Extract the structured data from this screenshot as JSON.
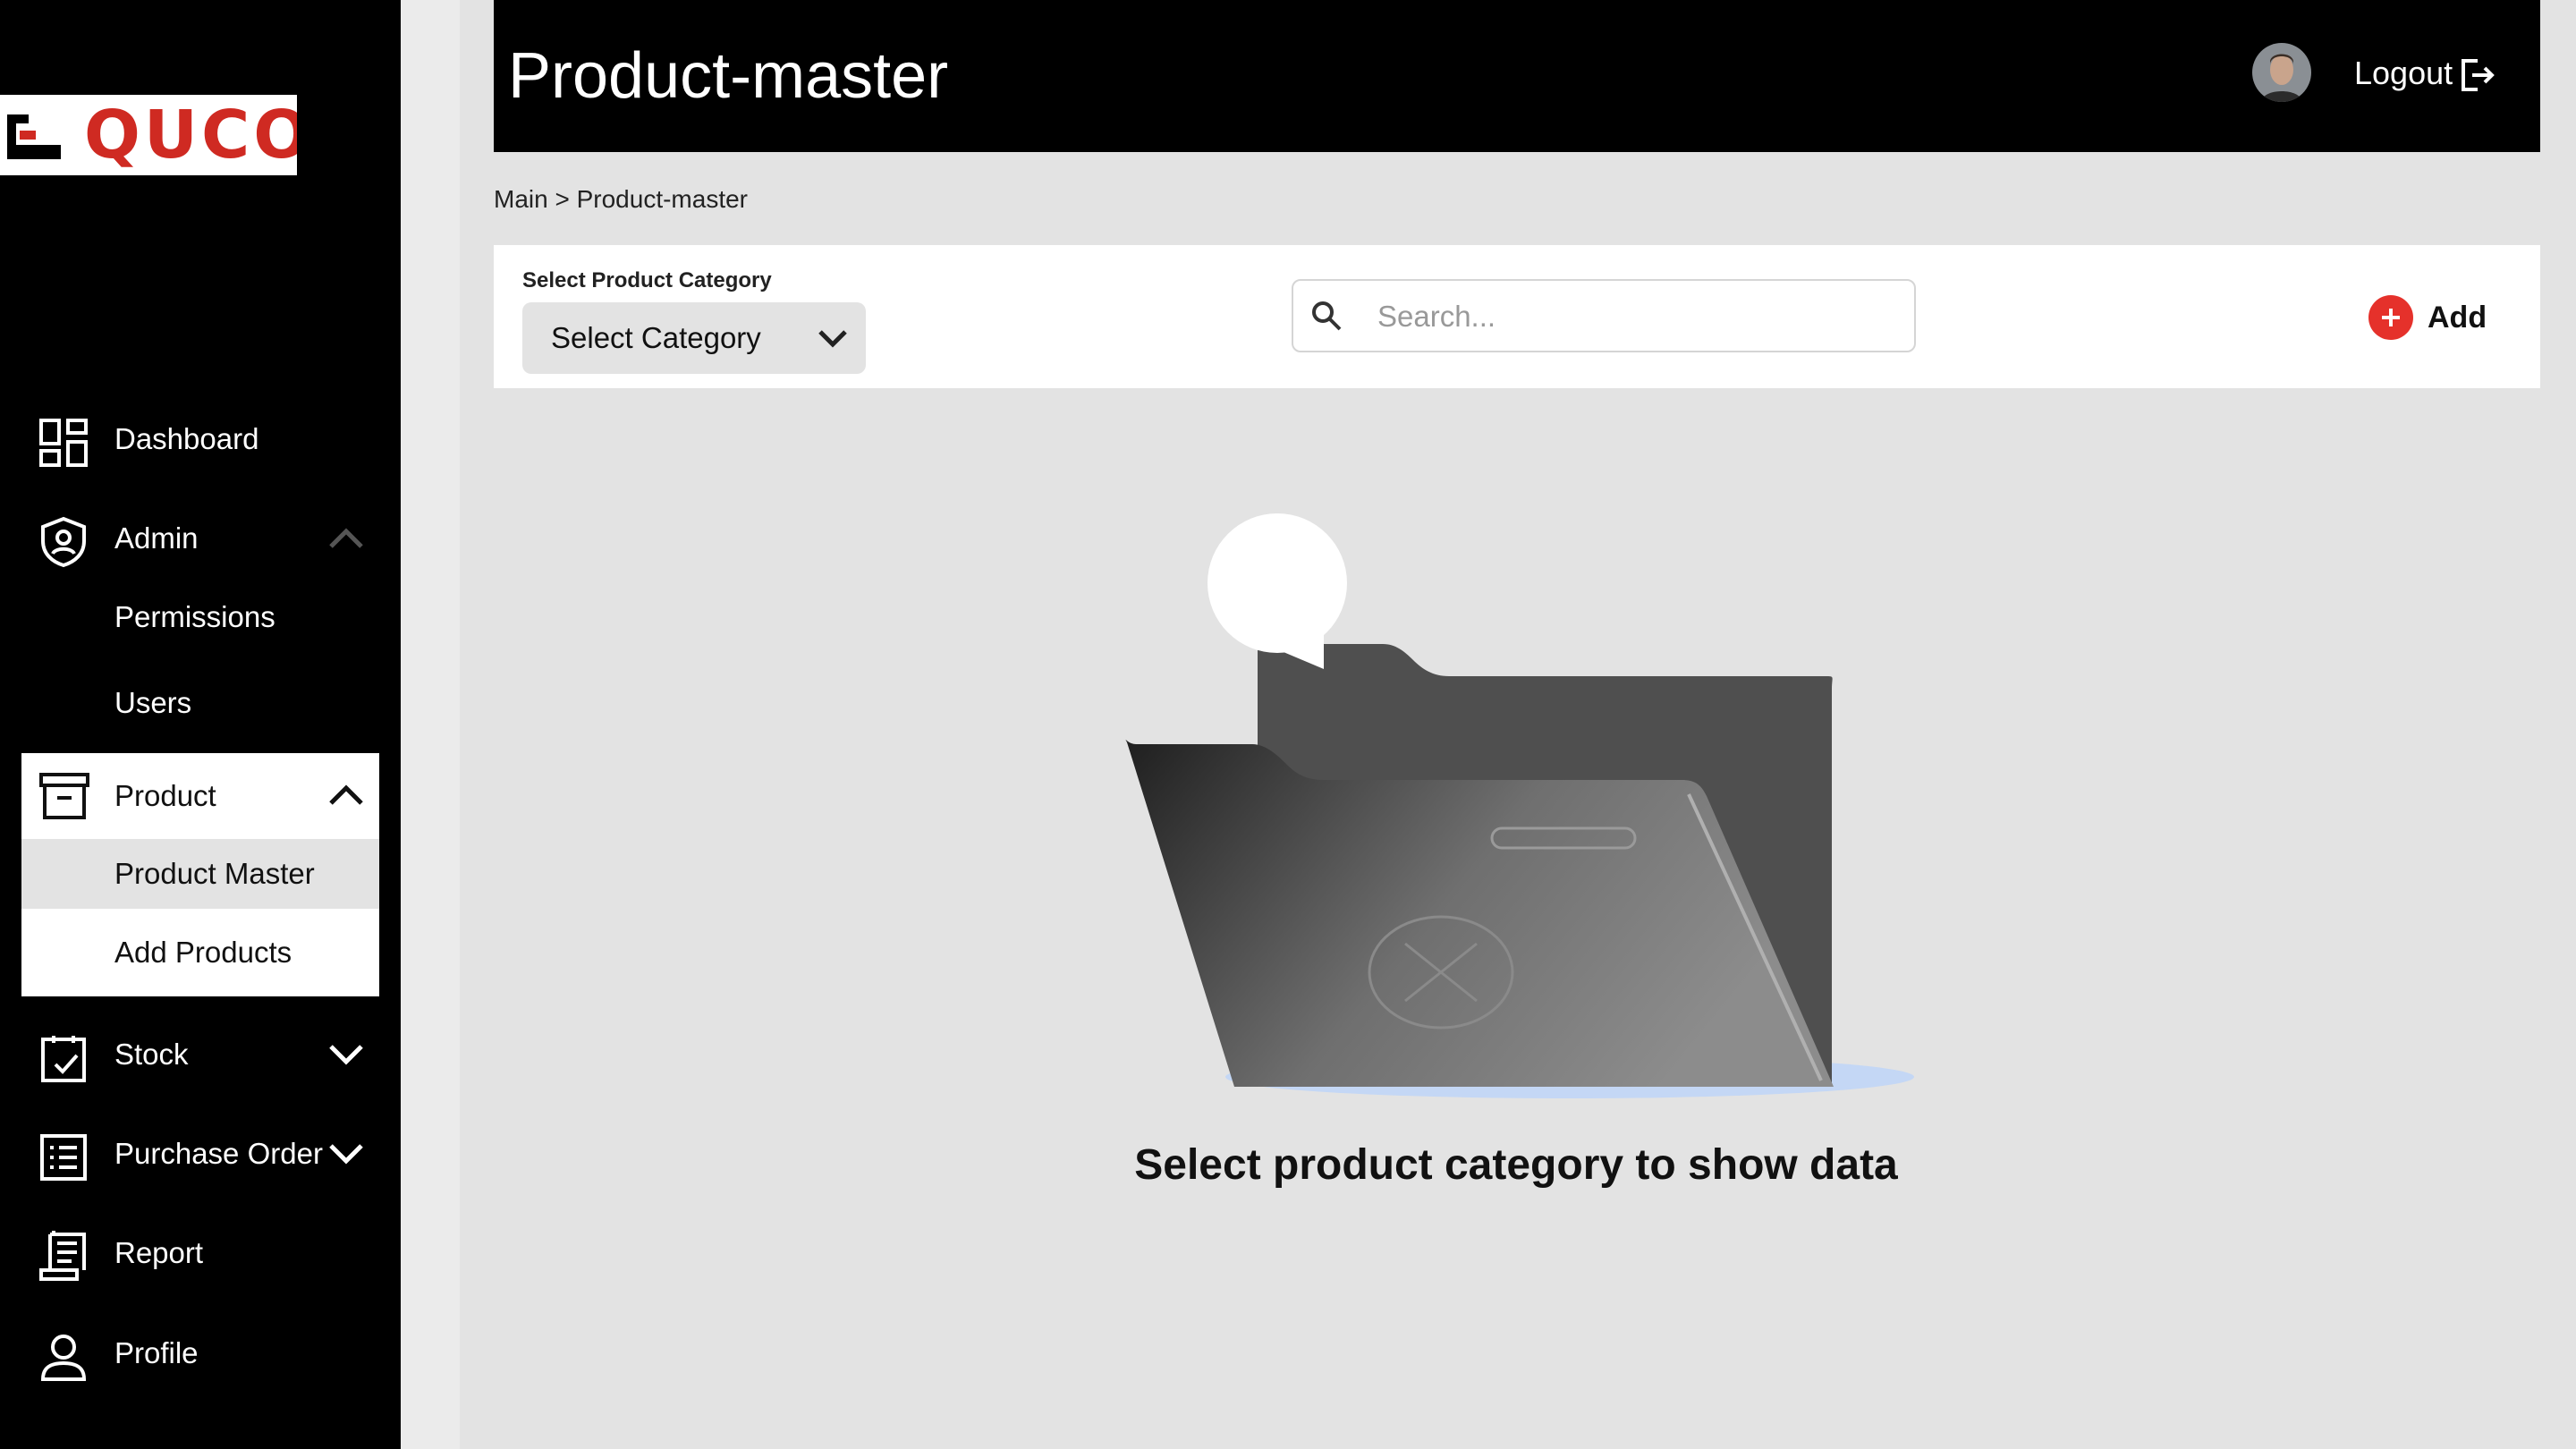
{
  "brand": {
    "logo_text": "QUCO"
  },
  "sidebar": {
    "items": [
      {
        "label": "Dashboard",
        "icon": "dashboard-icon"
      },
      {
        "label": "Admin",
        "icon": "shield-icon",
        "expanded": true,
        "children": [
          {
            "label": "Permissions"
          },
          {
            "label": "Users"
          }
        ]
      },
      {
        "label": "Product",
        "icon": "archive-box-icon",
        "expanded": true,
        "children": [
          {
            "label": "Product Master",
            "active": true
          },
          {
            "label": "Add Products"
          }
        ]
      },
      {
        "label": "Stock",
        "icon": "clipboard-check-icon",
        "expanded": false
      },
      {
        "label": "Purchase Order",
        "icon": "list-document-icon",
        "expanded": false
      },
      {
        "label": "Report",
        "icon": "receipt-icon"
      },
      {
        "label": "Profile",
        "icon": "user-icon"
      }
    ]
  },
  "header": {
    "title": "Product-master",
    "logout_label": "Logout"
  },
  "breadcrumb": "Main > Product-master",
  "filter": {
    "category_label": "Select Product Category",
    "category_value": "Select Category",
    "search_placeholder": "Search...",
    "add_label": "Add"
  },
  "empty_state": {
    "message": "Select product category to show data"
  },
  "colors": {
    "sidebar_bg": "#000000",
    "header_bg": "#000000",
    "page_bg": "#e3e3e3",
    "accent_red": "#e5312b",
    "logo_red": "#cf2a22"
  }
}
